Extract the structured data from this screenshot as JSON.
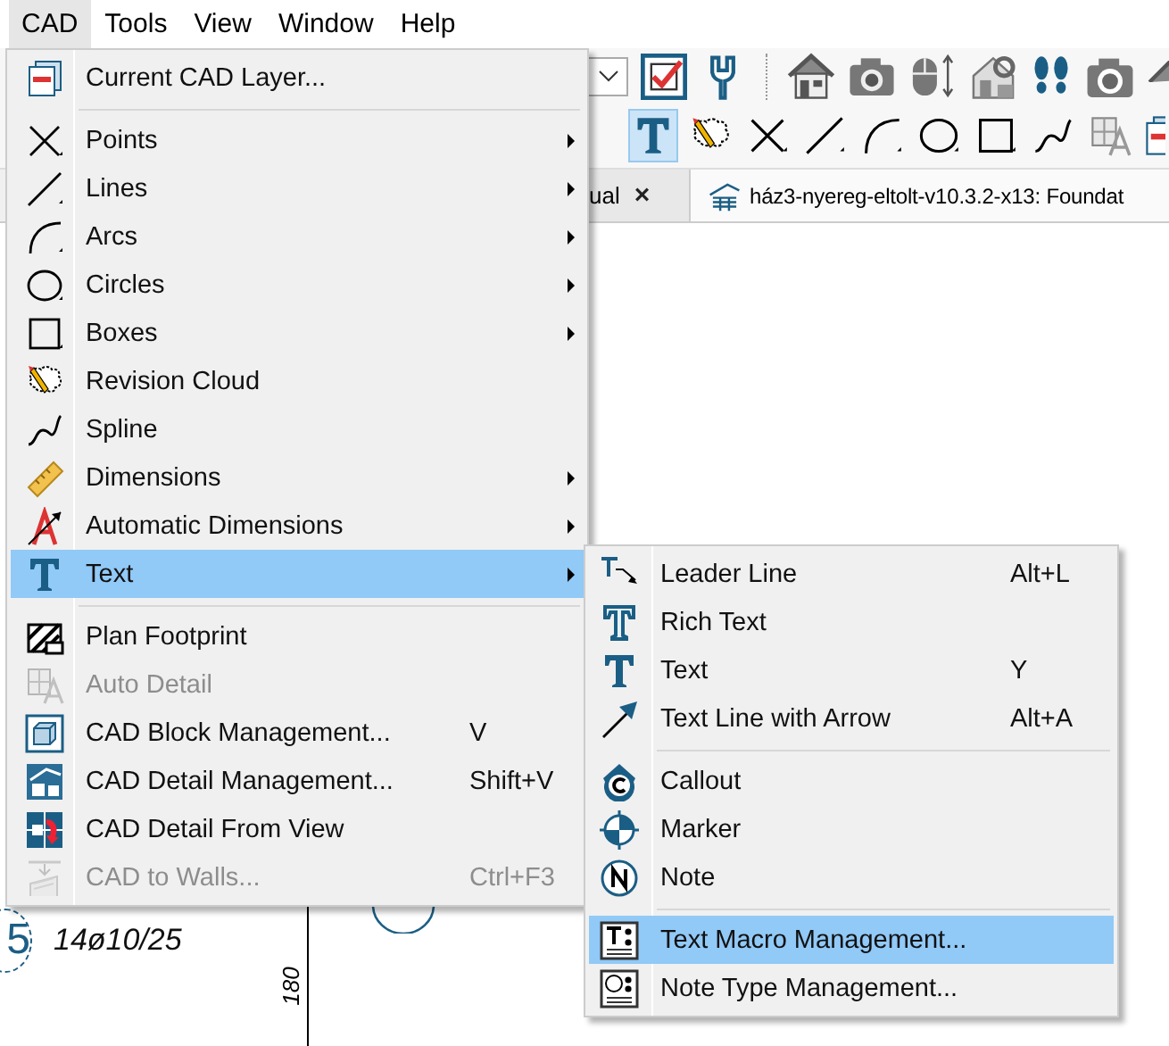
{
  "menubar": [
    {
      "label": "CAD",
      "selected": true
    },
    {
      "label": "Tools",
      "selected": false
    },
    {
      "label": "View",
      "selected": false
    },
    {
      "label": "Window",
      "selected": false
    },
    {
      "label": "Help",
      "selected": false
    }
  ],
  "toolbar_2": [
    {
      "selected": true
    },
    {
      "selected": false
    },
    {
      "selected": false
    },
    {
      "selected": false
    },
    {
      "selected": false
    },
    {
      "selected": false
    },
    {
      "selected": false
    },
    {
      "selected": false
    },
    {
      "selected": false
    }
  ],
  "tabs": [
    {
      "label": "ual",
      "close": "×"
    },
    {
      "label": "ház3-nyereg-eltolt-v10.3.2-x13: Foundat"
    }
  ],
  "drawing": {
    "labels": [
      {
        "kind": "callout",
        "text": "5"
      },
      {
        "kind": "text",
        "text": "14ø10/25"
      },
      {
        "kind": "dimension",
        "text": "180"
      }
    ]
  },
  "menu": {
    "items": [
      {
        "kind": "item",
        "label": "Current CAD Layer...",
        "submenu": false,
        "disabled": false,
        "selected": false
      },
      {
        "kind": "separator"
      },
      {
        "kind": "item",
        "label": "Points",
        "submenu": true,
        "disabled": false,
        "selected": false
      },
      {
        "kind": "item",
        "label": "Lines",
        "submenu": true,
        "disabled": false,
        "selected": false
      },
      {
        "kind": "item",
        "label": "Arcs",
        "submenu": true,
        "disabled": false,
        "selected": false
      },
      {
        "kind": "item",
        "label": "Circles",
        "submenu": true,
        "disabled": false,
        "selected": false
      },
      {
        "kind": "item",
        "label": "Boxes",
        "submenu": true,
        "disabled": false,
        "selected": false
      },
      {
        "kind": "item",
        "label": "Revision Cloud",
        "submenu": false,
        "disabled": false,
        "selected": false
      },
      {
        "kind": "item",
        "label": "Spline",
        "submenu": false,
        "disabled": false,
        "selected": false
      },
      {
        "kind": "item",
        "label": "Dimensions",
        "submenu": true,
        "disabled": false,
        "selected": false
      },
      {
        "kind": "item",
        "label": "Automatic Dimensions",
        "submenu": true,
        "disabled": false,
        "selected": false
      },
      {
        "kind": "item",
        "label": "Text",
        "submenu": true,
        "disabled": false,
        "selected": true
      },
      {
        "kind": "separator"
      },
      {
        "kind": "item",
        "label": "Plan Footprint",
        "submenu": false,
        "disabled": false,
        "selected": false
      },
      {
        "kind": "item",
        "label": "Auto Detail",
        "submenu": false,
        "disabled": true,
        "selected": false
      },
      {
        "kind": "item",
        "label": "CAD Block Management...",
        "shortcut": "V",
        "submenu": false,
        "disabled": false,
        "selected": false
      },
      {
        "kind": "item",
        "label": "CAD Detail Management...",
        "shortcut": "Shift+V",
        "submenu": false,
        "disabled": false,
        "selected": false
      },
      {
        "kind": "item",
        "label": "CAD Detail From View",
        "submenu": false,
        "disabled": false,
        "selected": false
      },
      {
        "kind": "item",
        "label": "CAD to Walls...",
        "shortcut": "Ctrl+F3",
        "submenu": false,
        "disabled": true,
        "selected": false
      }
    ]
  },
  "submenu": {
    "items": [
      {
        "kind": "item",
        "label": "Leader Line",
        "shortcut": "Alt+L",
        "selected": false
      },
      {
        "kind": "item",
        "label": "Rich Text",
        "selected": false
      },
      {
        "kind": "item",
        "label": "Text",
        "shortcut": "Y",
        "selected": false
      },
      {
        "kind": "item",
        "label": "Text Line with Arrow",
        "shortcut": "Alt+A",
        "selected": false
      },
      {
        "kind": "separator"
      },
      {
        "kind": "item",
        "label": "Callout",
        "selected": false
      },
      {
        "kind": "item",
        "label": "Marker",
        "selected": false
      },
      {
        "kind": "item",
        "label": "Note",
        "selected": false
      },
      {
        "kind": "separator"
      },
      {
        "kind": "item",
        "label": "Text Macro Management...",
        "selected": true
      },
      {
        "kind": "item",
        "label": "Note Type Management...",
        "selected": false
      }
    ]
  }
}
